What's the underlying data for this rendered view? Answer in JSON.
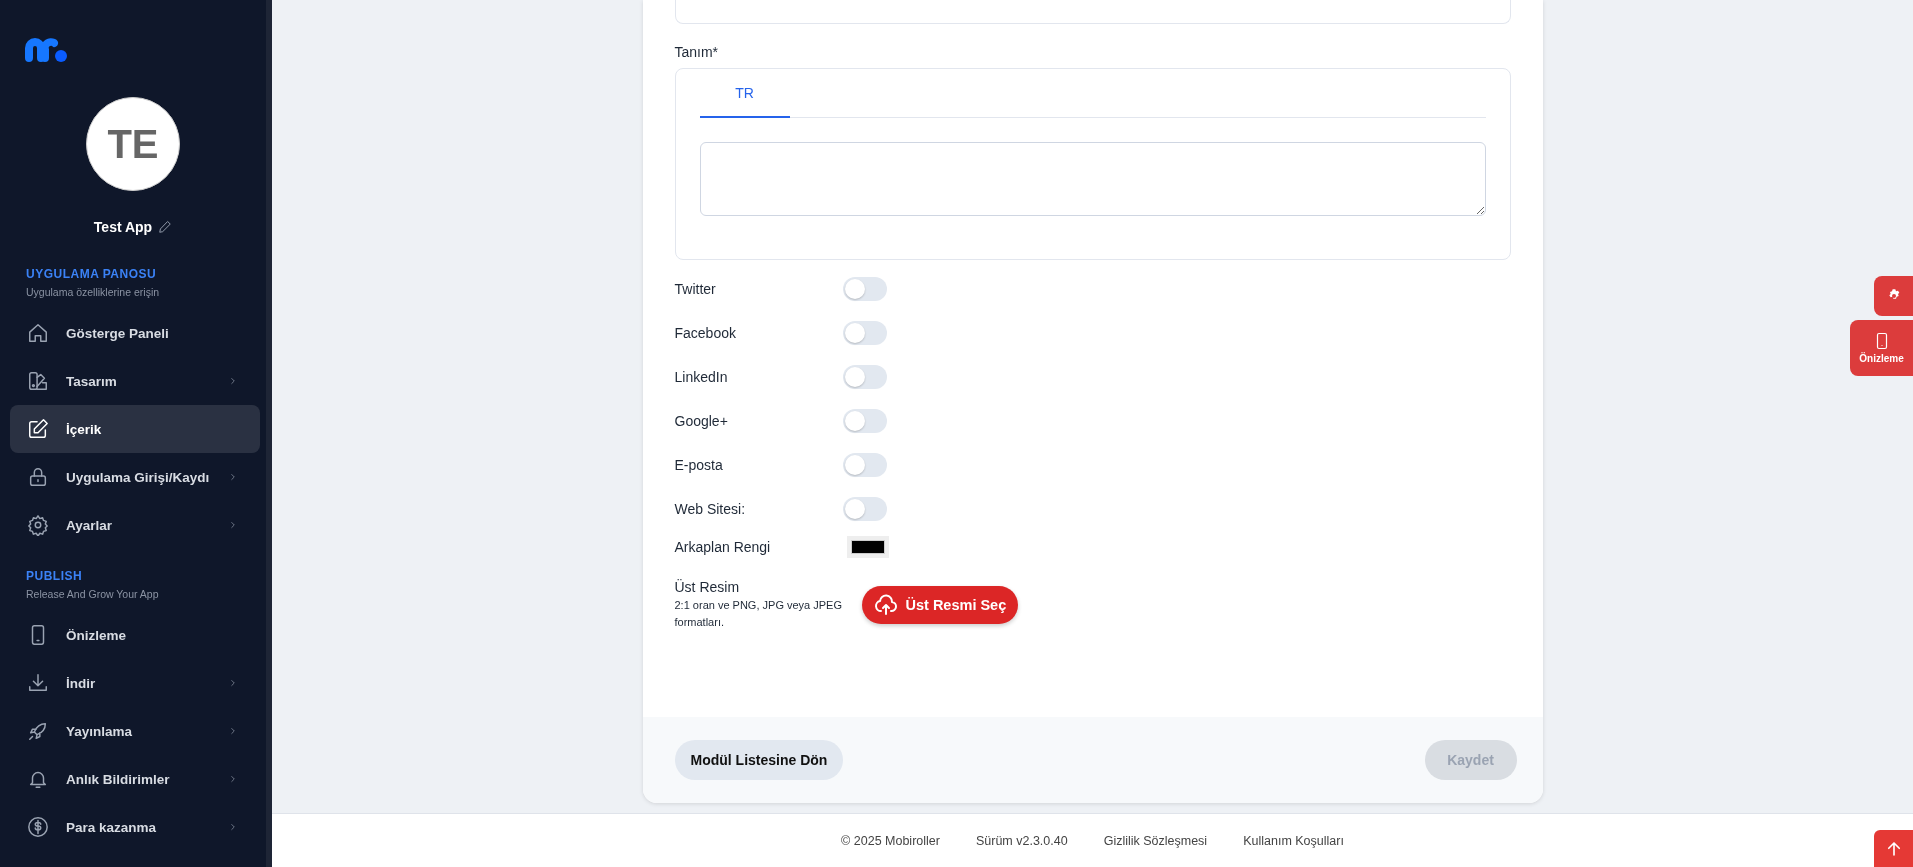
{
  "sidebar": {
    "avatar_initials": "TE",
    "app_name": "Test App",
    "sections": [
      {
        "title": "UYGULAMA PANOSU",
        "subtitle": "Uygulama özelliklerine erişin",
        "items": [
          {
            "label": "Gösterge Paneli",
            "has_submenu": false,
            "selected": false
          },
          {
            "label": "Tasarım",
            "has_submenu": true,
            "selected": false
          },
          {
            "label": "İçerik",
            "has_submenu": false,
            "selected": true
          },
          {
            "label": "Uygulama Girişi/Kaydı",
            "has_submenu": true,
            "selected": false
          },
          {
            "label": "Ayarlar",
            "has_submenu": true,
            "selected": false
          }
        ]
      },
      {
        "title": "PUBLISH",
        "subtitle": "Release And Grow Your App",
        "items": [
          {
            "label": "Önizleme",
            "has_submenu": false,
            "selected": false
          },
          {
            "label": "İndir",
            "has_submenu": true,
            "selected": false
          },
          {
            "label": "Yayınlama",
            "has_submenu": true,
            "selected": false
          },
          {
            "label": "Anlık Bildirimler",
            "has_submenu": true,
            "selected": false
          },
          {
            "label": "Para kazanma",
            "has_submenu": true,
            "selected": false
          }
        ]
      }
    ]
  },
  "form": {
    "description": {
      "label": "Tanım*",
      "tabs": [
        {
          "label": "TR",
          "selected": true
        }
      ]
    },
    "toggles": [
      {
        "label": "Twitter",
        "on": false
      },
      {
        "label": "Facebook",
        "on": false
      },
      {
        "label": "LinkedIn",
        "on": false
      },
      {
        "label": "Google+",
        "on": false
      },
      {
        "label": "E-posta",
        "on": false
      },
      {
        "label": "Web Sitesi:",
        "on": false
      }
    ],
    "background_color": {
      "label": "Arkaplan Rengi",
      "color": "#000000"
    },
    "header_image": {
      "label": "Üst Resim",
      "hint": "2:1 oran ve PNG, JPG veya JPEG formatları.",
      "button": "Üst Resmi Seç"
    },
    "back_button": "Modül Listesine Dön",
    "save_button": {
      "label": "Kaydet",
      "disabled": true
    }
  },
  "floating": {
    "preview_label": "Önizleme"
  },
  "footer": {
    "items": [
      "© 2025 Mobiroller",
      "Sürüm v2.3.0.40",
      "Gizlilik Sözleşmesi",
      "Kullanım Koşulları"
    ]
  }
}
